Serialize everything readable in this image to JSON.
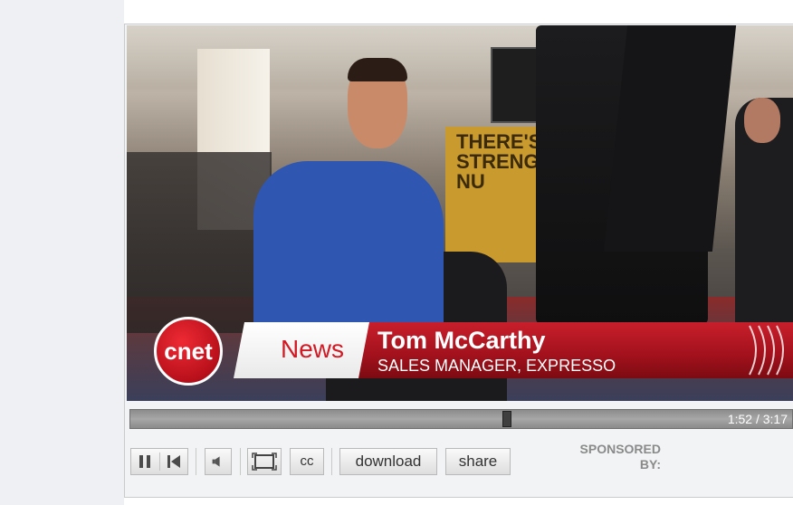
{
  "lower_third": {
    "logo_text": "cnet",
    "news_label": "News",
    "name": "Tom McCarthy",
    "title": "SALES MANAGER, EXPRESSO"
  },
  "video_scene": {
    "booth_sign": "THERE'S STRENG IN NU"
  },
  "playback": {
    "time_display": "1:52 / 3:17",
    "progress": 0.57
  },
  "controls": {
    "cc_label": "cc",
    "download_label": "download",
    "share_label": "share",
    "sponsored_line1": "SPONSORED",
    "sponsored_line2": "BY:"
  },
  "icons": {
    "pause": "pause-icon",
    "previous": "skip-back-icon",
    "volume": "speaker-icon",
    "fullscreen": "fullscreen-icon"
  },
  "colors": {
    "cnet_red": "#c81f2b",
    "seek_bar": "#9a9a9a",
    "sponsored_text": "#8a8a8a"
  }
}
